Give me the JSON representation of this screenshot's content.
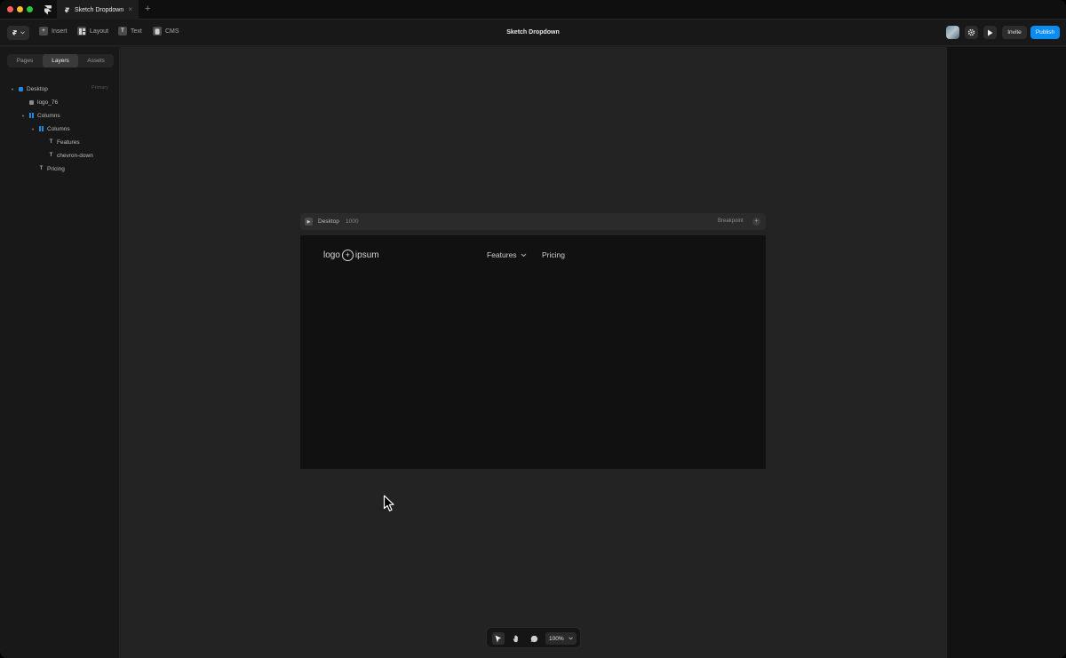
{
  "window": {
    "tab_title": "Sketch Dropdown",
    "tab_close": "×",
    "tab_add": "+"
  },
  "toolbar": {
    "insert": "Insert",
    "layout": "Layout",
    "text": "Text",
    "cms": "CMS",
    "document_title": "Sketch Dropdown",
    "invite": "Invite",
    "publish": "Publish"
  },
  "left_panel": {
    "tabs": [
      "Pages",
      "Layers",
      "Assets"
    ],
    "active_tab": "Layers",
    "layers": [
      {
        "label": "Desktop",
        "tag": "Primary"
      },
      {
        "label": "logo_76"
      },
      {
        "label": "Columns"
      },
      {
        "label": "Columns"
      },
      {
        "label": "Features"
      },
      {
        "label": "chevron-down"
      },
      {
        "label": "Pricing"
      }
    ]
  },
  "canvas": {
    "frame_label": "Desktop",
    "frame_width": "1000",
    "breakpoint": "Breakpoint",
    "logo_left": "logo",
    "logo_right": "ipsum",
    "nav_features": "Features",
    "nav_pricing": "Pricing"
  },
  "bottom_bar": {
    "zoom": "100%"
  },
  "colors": {
    "accent": "#0a8cf0",
    "layer_frame": "#1e88e5"
  }
}
